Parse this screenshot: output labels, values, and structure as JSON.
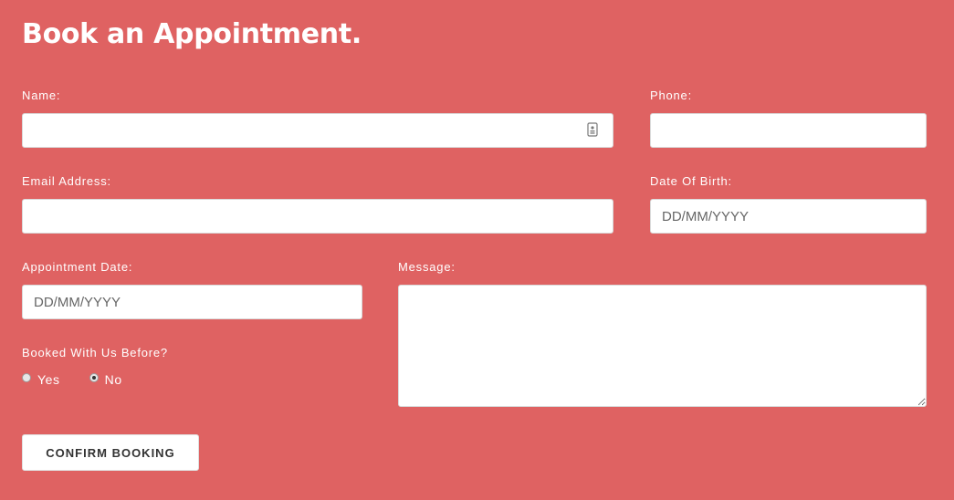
{
  "form": {
    "title": "Book an Appointment.",
    "name": {
      "label": "Name:",
      "value": "",
      "placeholder": ""
    },
    "phone": {
      "label": "Phone:",
      "value": "",
      "placeholder": ""
    },
    "email": {
      "label": "Email Address:",
      "value": "",
      "placeholder": ""
    },
    "dob": {
      "label": "Date Of Birth:",
      "value": "",
      "placeholder": "DD/MM/YYYY"
    },
    "appointment_date": {
      "label": "Appointment Date:",
      "value": "",
      "placeholder": "DD/MM/YYYY"
    },
    "message": {
      "label": "Message:",
      "value": "",
      "placeholder": ""
    },
    "booked_before": {
      "label": "Booked With Us Before?",
      "options": [
        "Yes",
        "No"
      ],
      "selected": "No"
    },
    "submit_label": "CONFIRM BOOKING"
  },
  "colors": {
    "background": "#df6262",
    "field_background": "#ffffff",
    "button_text": "#333333"
  },
  "icons": {
    "name_field_icon": "contact-card-icon"
  }
}
